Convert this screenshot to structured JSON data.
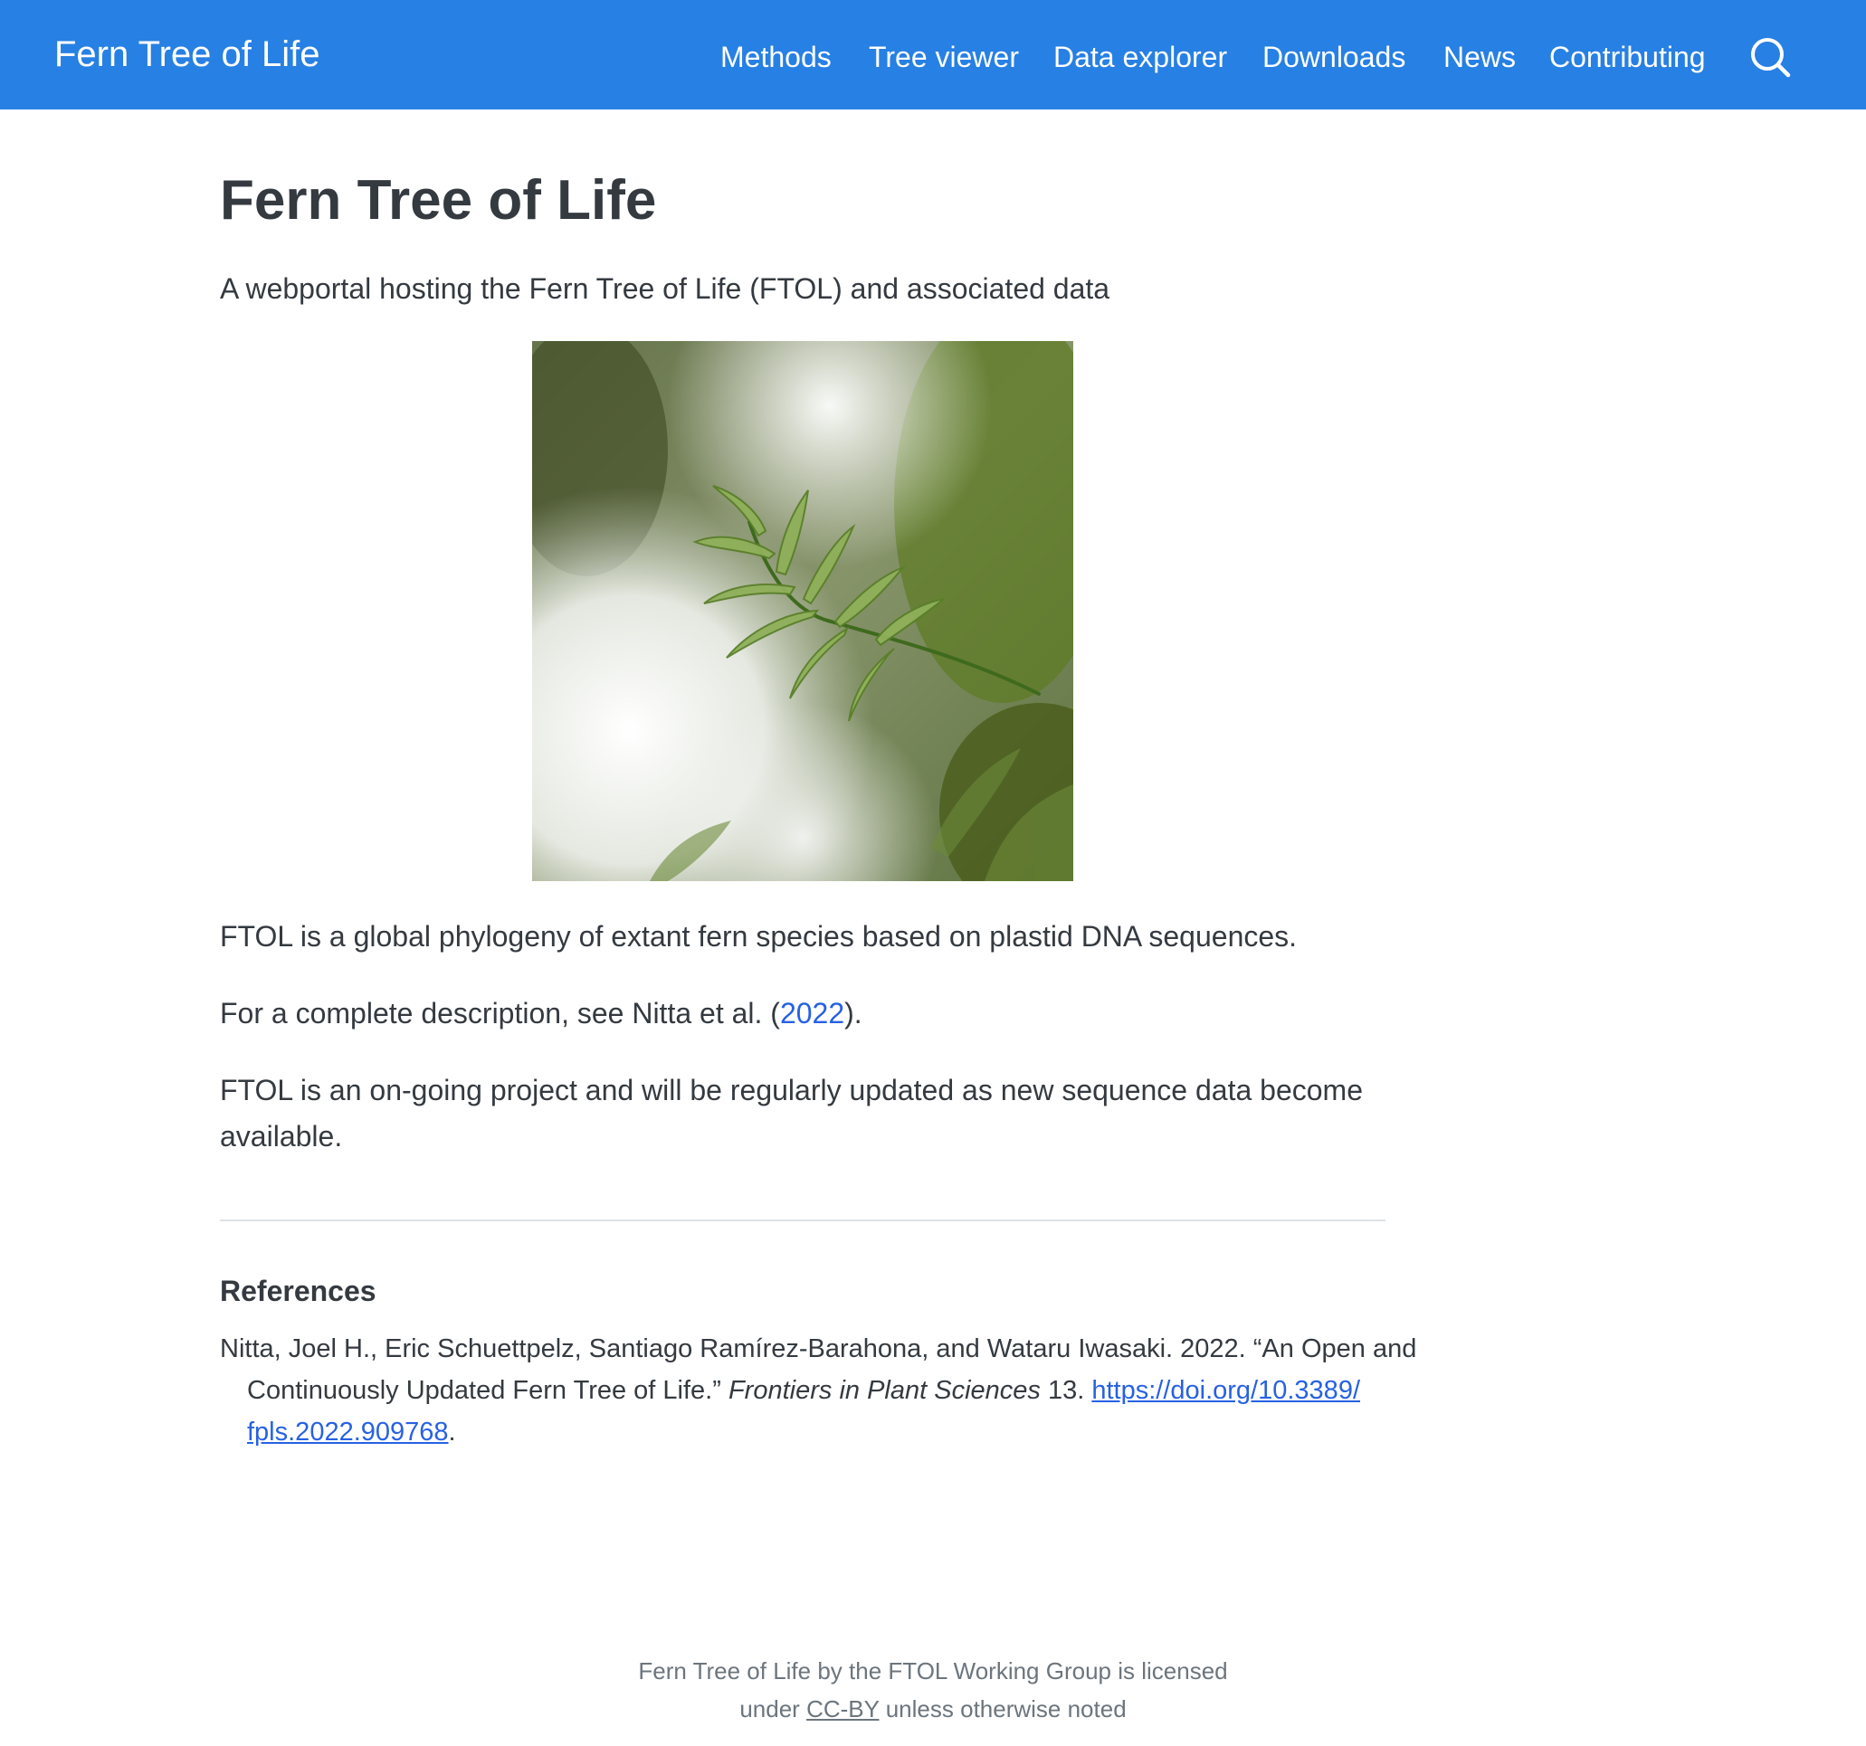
{
  "navbar": {
    "brand": "Fern Tree of Life",
    "links": [
      "Methods",
      "Tree viewer",
      "Data explorer",
      "Downloads",
      "News",
      "Contributing"
    ],
    "search_icon": "search-icon",
    "background": "#2780e3"
  },
  "main": {
    "title": "Fern Tree of Life",
    "subtitle": "A webportal hosting the Fern Tree of Life (FTOL) and associated data",
    "paragraph1": "FTOL is a global phylogeny of extant fern species based on plastid DNA sequences.",
    "paragraph2": {
      "prefix": "For a complete description, see Nitta et al. (",
      "link": "2022",
      "suffix": ")."
    },
    "paragraph3_line1": "FTOL is an on-going project and will be regularly updated as new sequence data become",
    "paragraph3_line2": "available."
  },
  "references": {
    "heading": "References",
    "line1": "Nitta, Joel H., Eric Schuettpelz, Santiago Ramírez-Barahona, and Wataru Iwasaki. 2022. “An Open and",
    "line2_text": "Continuously Updated Fern Tree of Life.” ",
    "journal": "Frontiers in Plant Sciences",
    "volume": " 13. ",
    "doi_part1": "https://doi.org/10.3389/",
    "doi_part2": "fpls.2022.909768",
    "end": "."
  },
  "footer": {
    "line1": "Fern Tree of Life by the FTOL Working Group is licensed",
    "line2_prefix": "under ",
    "license_link": "CC-BY",
    "line2_suffix": " unless otherwise noted"
  },
  "colors": {
    "accent": "#2780e3",
    "link": "#2761e3",
    "text": "#343a40",
    "muted": "#6c757d"
  }
}
